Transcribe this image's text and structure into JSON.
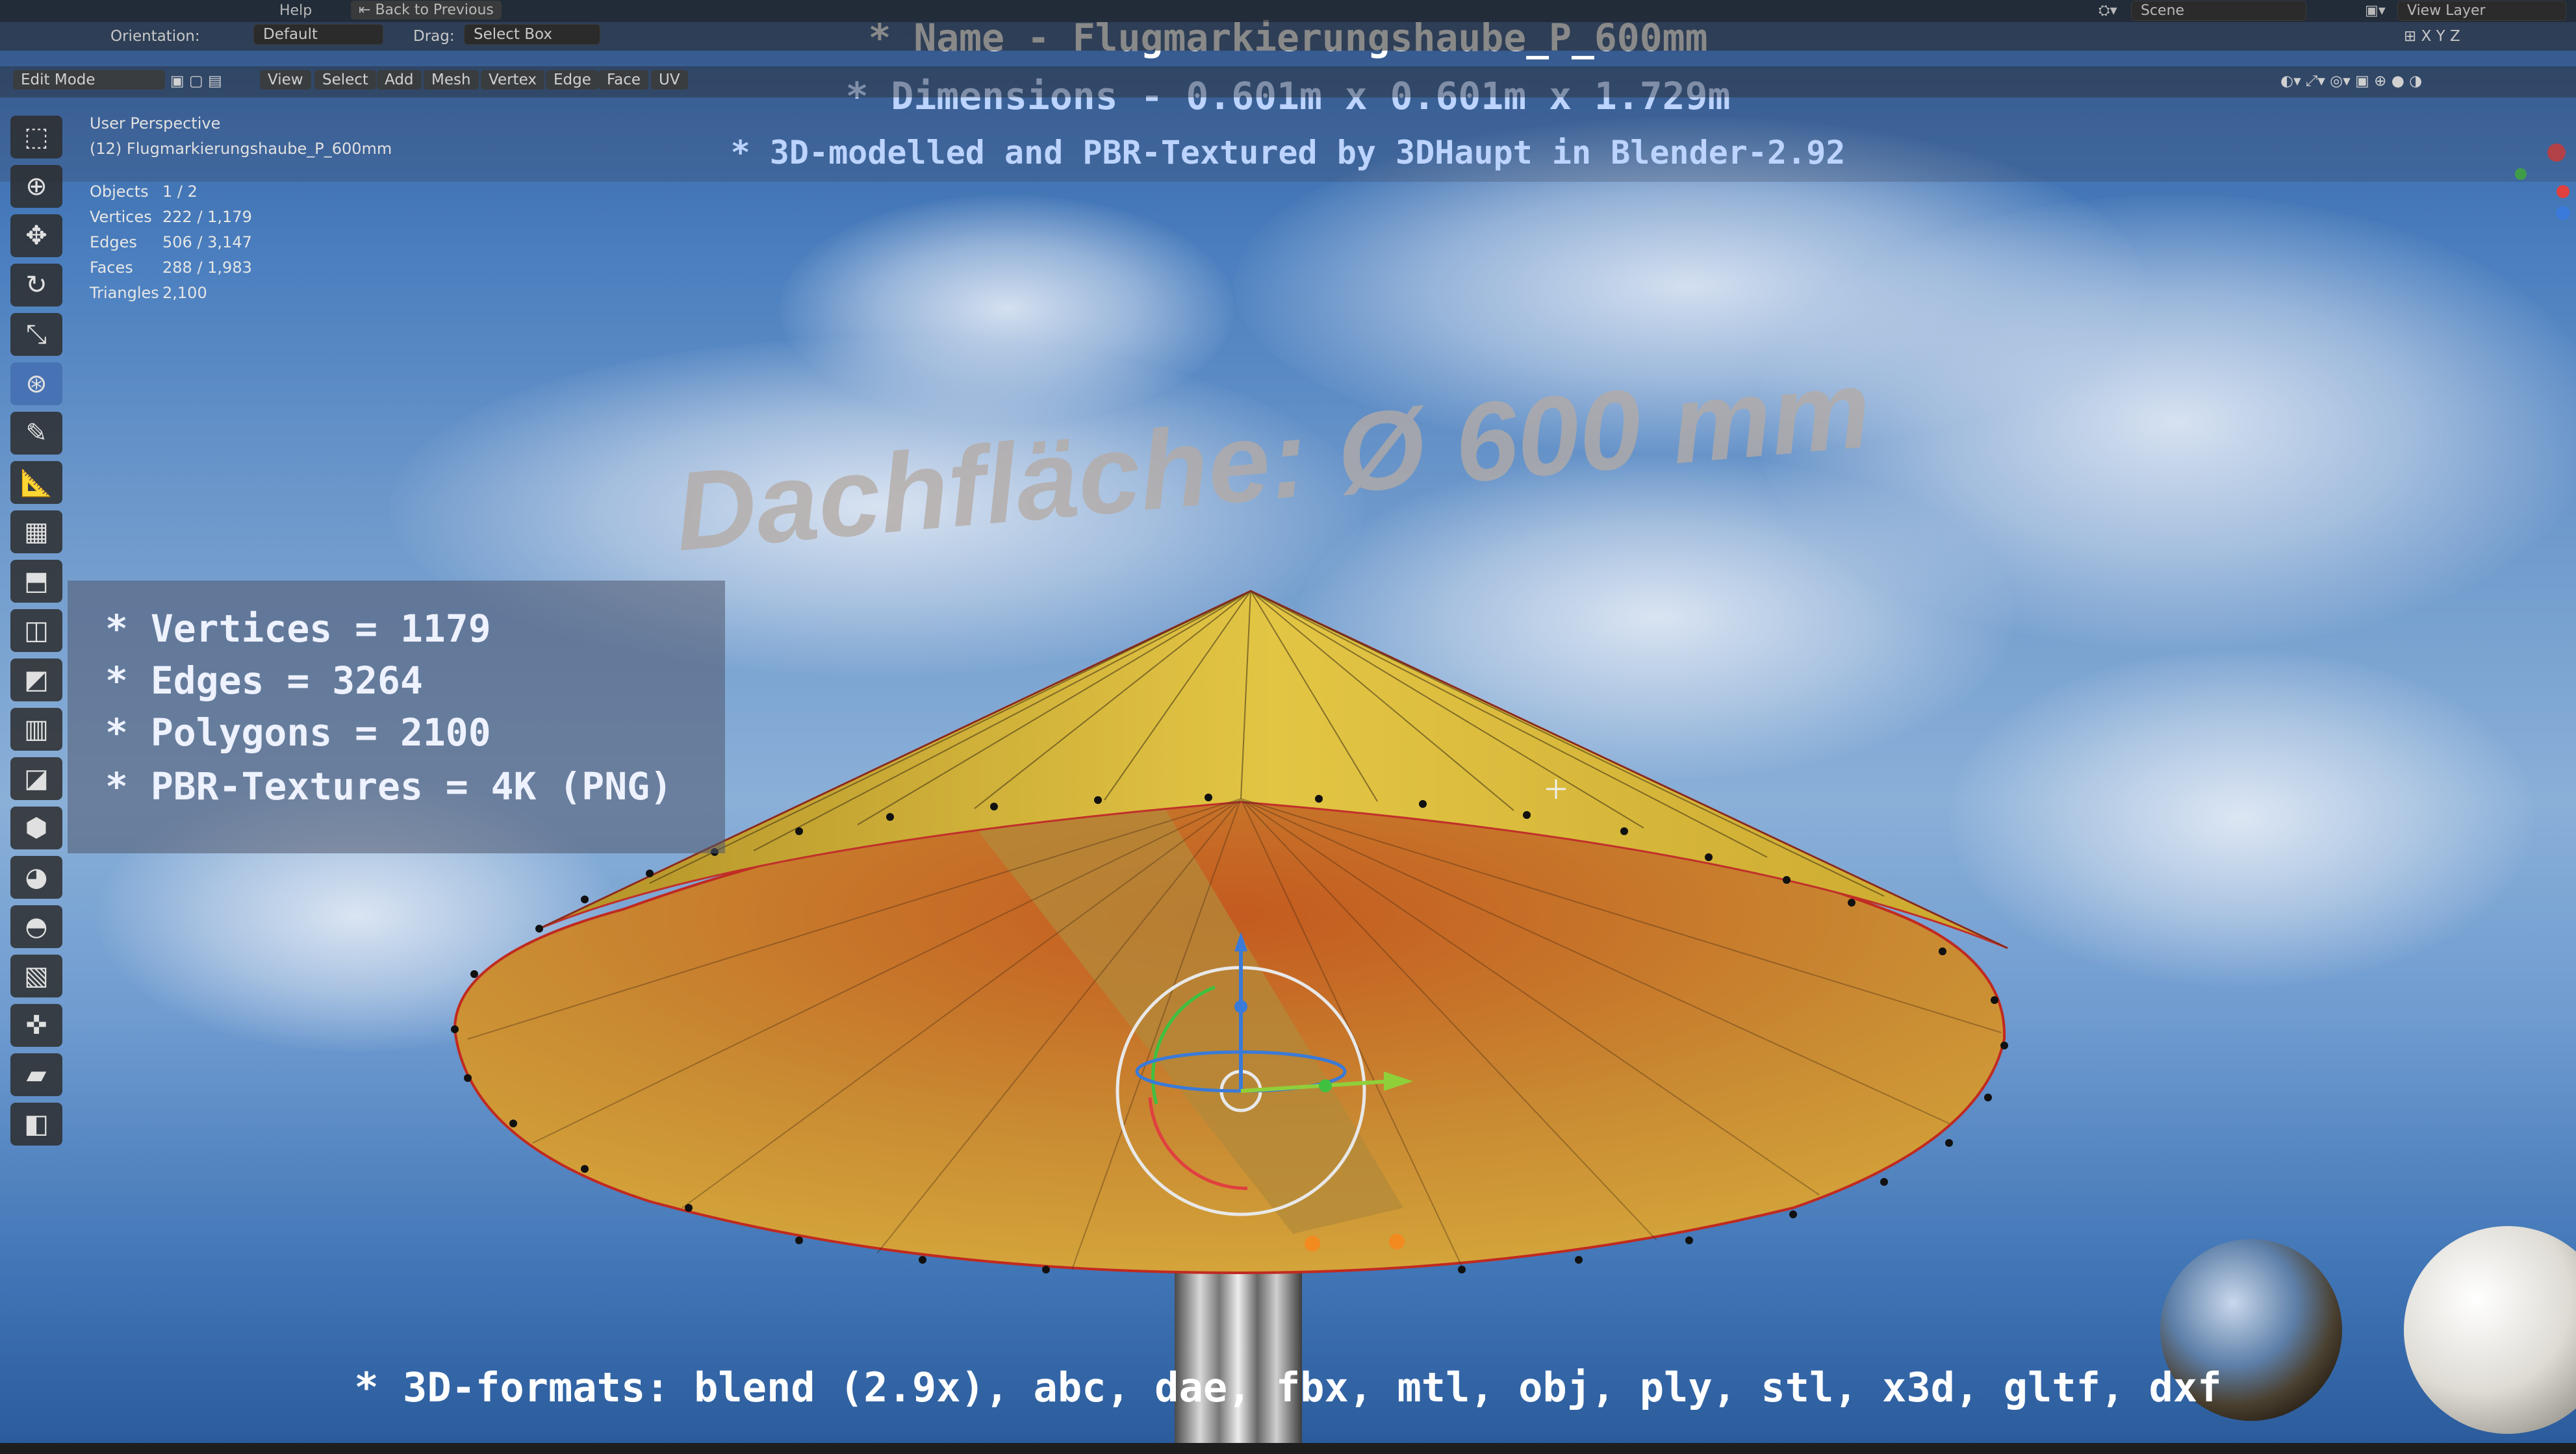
{
  "topbar": {
    "menu_help": "Help",
    "back_button": "Back to Previous",
    "scene_label": "Scene",
    "view_layer_label": "View Layer"
  },
  "header": {
    "orientation_label": "Orientation:",
    "orientation_value": "Default",
    "drag_label": "Drag:",
    "drag_value": "Select Box"
  },
  "modebar": {
    "mode": "Edit Mode",
    "menus": [
      "View",
      "Select",
      "Add",
      "Mesh",
      "Vertex",
      "Edge",
      "Face",
      "UV"
    ]
  },
  "viewport": {
    "perspective": "User Perspective",
    "object_name": "(12) Flugmarkierungshaube_P_600mm",
    "stats": [
      {
        "k": "Objects",
        "v": "1 / 2"
      },
      {
        "k": "Vertices",
        "v": "222 / 1,179"
      },
      {
        "k": "Edges",
        "v": "506 / 3,147"
      },
      {
        "k": "Faces",
        "v": "288 / 1,983"
      },
      {
        "k": "Triangles",
        "v": "2,100"
      }
    ],
    "overlay_3d_text": "Dachfläche:  Ø 600 mm"
  },
  "overlay": {
    "name_line": "* Name - Flugmarkierungshaube_P_600mm",
    "dimensions_line": "* Dimensions -  0.601m x 0.601m x 1.729m",
    "credit_line": "* 3D-modelled and PBR-Textured by 3DHaupt in Blender-2.92",
    "info_lines": [
      "* Vertices = 1179",
      "* Edges = 3264",
      "* Polygons = 2100",
      "* PBR-Textures = 4K (PNG)"
    ],
    "formats_line": "* 3D-formats: blend (2.9x), abc, dae, fbx, mtl, obj, ply, stl, x3d, gltf, dxf"
  },
  "colors": {
    "accent": "#4772b3",
    "title_white": "#ffffff",
    "subtitle_blue": "#bcd4ff",
    "cone_yellow": "#d8b43a",
    "cone_orange": "#c0622a"
  },
  "toolbar_icons": [
    "select-box-icon",
    "cursor-icon",
    "move-icon",
    "rotate-icon",
    "scale-icon",
    "transform-icon",
    "annotate-icon",
    "measure-icon",
    "add-cube-icon",
    "extrude-icon",
    "inset-icon",
    "bevel-icon",
    "loop-cut-icon",
    "knife-icon",
    "poly-build-icon",
    "spin-icon",
    "smooth-icon",
    "edge-slide-icon",
    "shrink-fatten-icon",
    "shear-icon",
    "rip-icon"
  ]
}
